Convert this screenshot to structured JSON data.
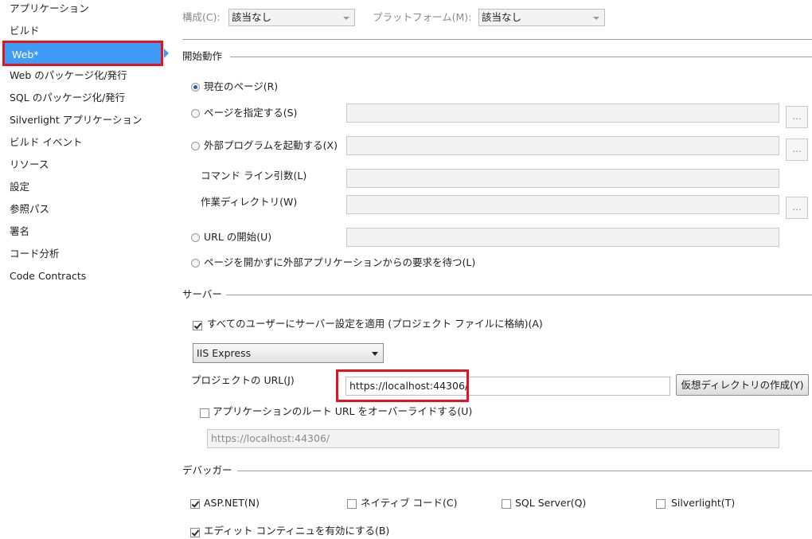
{
  "sidebar": {
    "items": [
      {
        "label": "アプリケーション"
      },
      {
        "label": "ビルド"
      },
      {
        "label": "Web*"
      },
      {
        "label": "Web のパッケージ化/発行"
      },
      {
        "label": "SQL のパッケージ化/発行"
      },
      {
        "label": "Silverlight アプリケーション"
      },
      {
        "label": "ビルド イベント"
      },
      {
        "label": "リソース"
      },
      {
        "label": "設定"
      },
      {
        "label": "参照パス"
      },
      {
        "label": "署名"
      },
      {
        "label": "コード分析"
      },
      {
        "label": "Code Contracts"
      }
    ],
    "active_index": 2
  },
  "top": {
    "config_label": "構成(C):",
    "config_value": "該当なし",
    "platform_label": "プラットフォーム(M):",
    "platform_value": "該当なし"
  },
  "start_action": {
    "title": "開始動作",
    "current_page": "現在のページ(R)",
    "specific_page": "ページを指定する(S)",
    "external_program": "外部プログラムを起動する(X)",
    "command_args": "コマンド ライン引数(L)",
    "working_dir": "作業ディレクトリ(W)",
    "start_url": "URL の開始(U)",
    "wait_request": "ページを開かずに外部アプリケーションからの要求を待つ(L)",
    "browse_label": "..."
  },
  "servers": {
    "title": "サーバー",
    "apply_all": "すべてのユーザーにサーバー設定を適用 (プロジェクト ファイルに格納)(A)",
    "server_type": "IIS Express",
    "project_url_label": "プロジェクトの URL(J)",
    "project_url_value": "https://localhost:44306/",
    "create_vdir_button": "仮想ディレクトリの作成(Y)",
    "override_root": "アプリケーションのルート URL をオーバーライドする(U)",
    "override_value": "https://localhost:44306/"
  },
  "debuggers": {
    "title": "デバッガー",
    "aspnet": "ASP.NET(N)",
    "native": "ネイティブ コード(C)",
    "sql": "SQL Server(Q)",
    "silverlight": "Silverlight(T)",
    "edit_continue": "エディット コンティニュを有効にする(B)"
  },
  "colors": {
    "selection": "#3f9bf5",
    "highlight_border": "#e3141f"
  }
}
